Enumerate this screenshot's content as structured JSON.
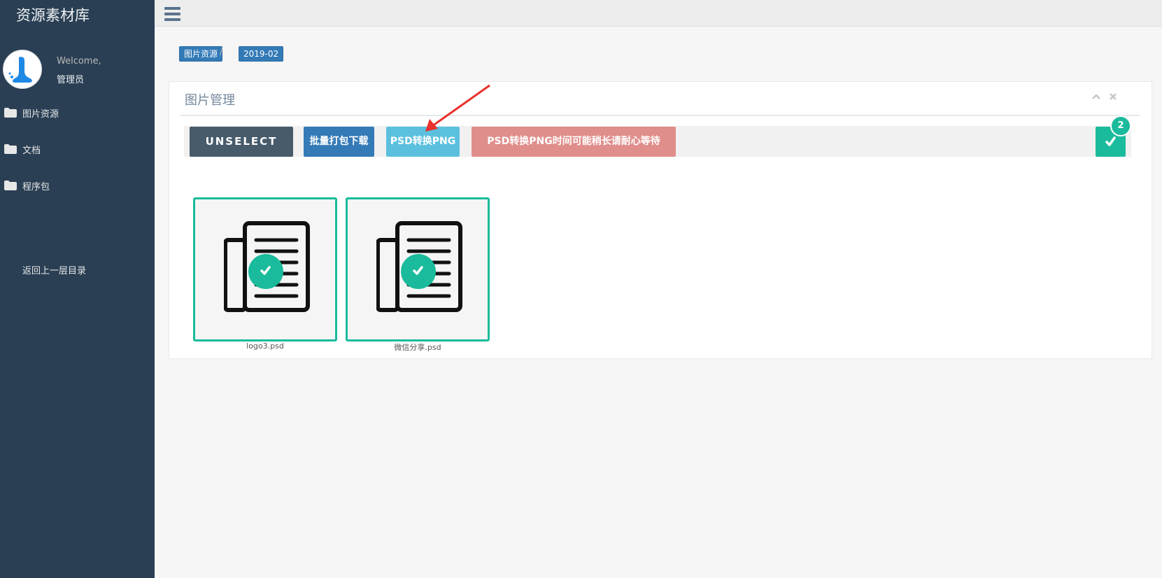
{
  "sidebar": {
    "app_title": "资源素材库",
    "welcome": "Welcome,",
    "username": "管理员",
    "items": [
      {
        "label": "图片资源"
      },
      {
        "label": "文档"
      },
      {
        "label": "程序包"
      }
    ],
    "back_label": "返回上一层目录"
  },
  "breadcrumb": {
    "items": [
      "图片资源",
      "2019-02"
    ],
    "separator": "/"
  },
  "panel": {
    "title": "图片管理"
  },
  "toolbar": {
    "unselect_label": "UNSELECT",
    "batch_download_label": "批量打包下载",
    "convert_label": "PSD转换PNG",
    "notice_label": "PSD转换PNG时间可能稍长请耐心等待",
    "selected_count": "2"
  },
  "files": [
    {
      "name": "logo3.psd",
      "selected": true
    },
    {
      "name": "微信分享.psd",
      "selected": true
    }
  ],
  "colors": {
    "sidebar_bg": "#2a3f54",
    "accent_green": "#1abb9c",
    "primary_blue": "#337ab7",
    "info_blue": "#5bc0de",
    "danger_light": "#e08e8b",
    "dark_button": "#475b6b"
  }
}
